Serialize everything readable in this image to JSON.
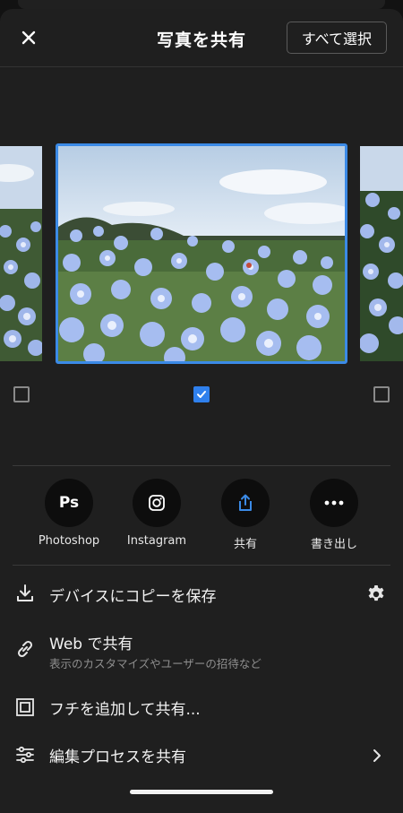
{
  "header": {
    "title": "写真を共有",
    "select_all_label": "すべて選択"
  },
  "photos": [
    {
      "selected": false
    },
    {
      "selected": true
    },
    {
      "selected": false
    }
  ],
  "actions": [
    {
      "icon": "photoshop-icon",
      "icon_text": "Ps",
      "label": "Photoshop"
    },
    {
      "icon": "instagram-icon",
      "label": "Instagram"
    },
    {
      "icon": "share-icon",
      "label": "共有"
    },
    {
      "icon": "more-icon",
      "label": "書き出し"
    }
  ],
  "menu": {
    "save_to_device": "デバイスにコピーを保存",
    "web_share": "Web で共有",
    "web_share_sub": "表示のカスタマイズやユーザーの招待など",
    "add_border": "フチを追加して共有...",
    "share_edit_process": "編集プロセスを共有"
  },
  "colors": {
    "accent": "#2f80ed",
    "selection_border": "#3b8ae6",
    "background": "#1f1f1f"
  }
}
